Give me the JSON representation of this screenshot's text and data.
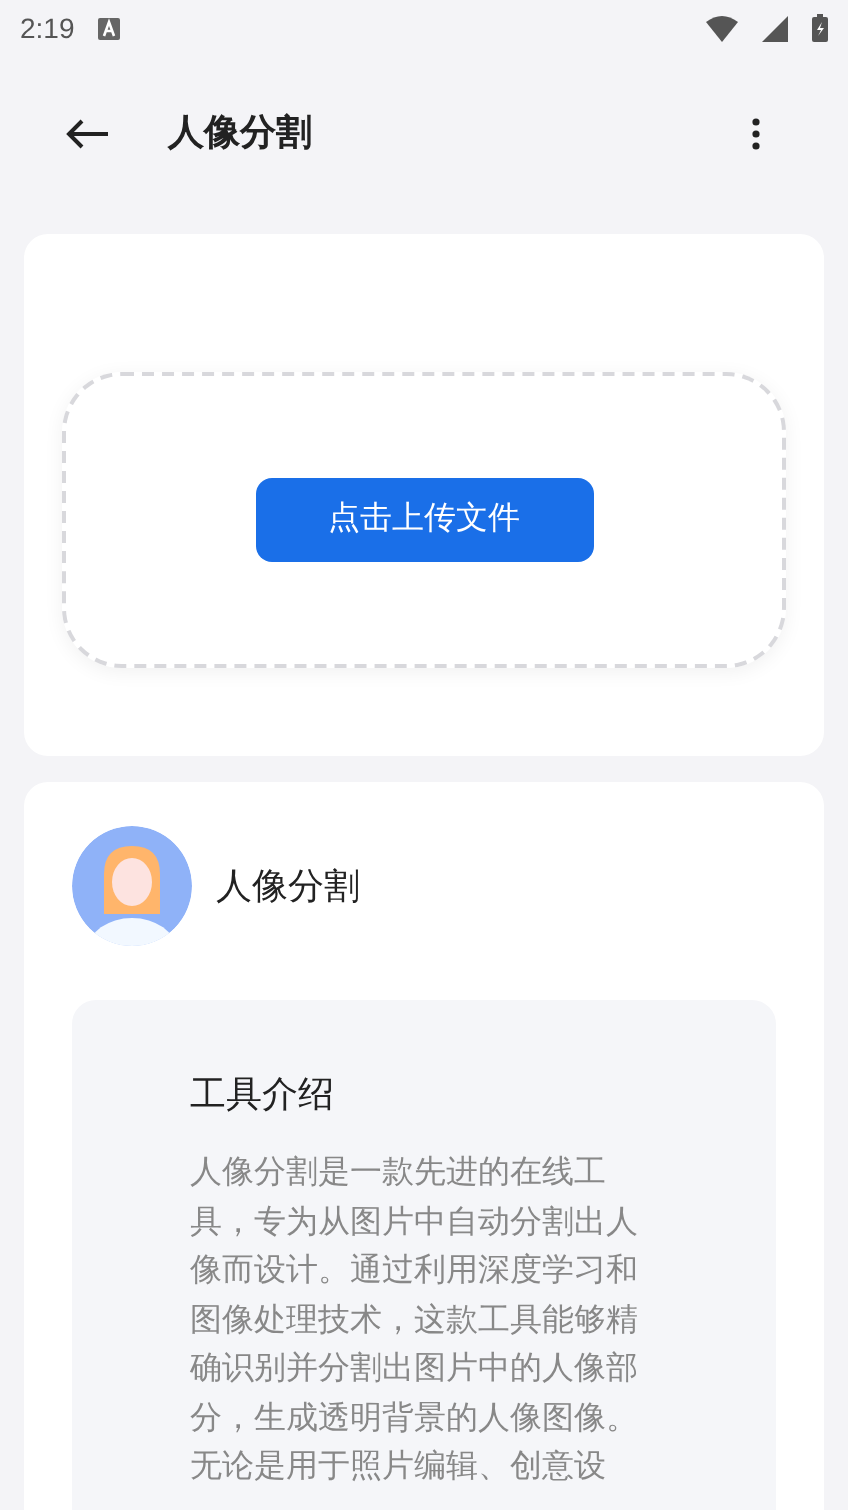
{
  "status_bar": {
    "time": "2:19"
  },
  "app_bar": {
    "title": "人像分割"
  },
  "upload": {
    "button": "点击上传文件"
  },
  "tool": {
    "name": "人像分割",
    "intro_title": "工具介绍",
    "intro_text": "人像分割是一款先进的在线工具，专为从图片中自动分割出人像而设计。通过利用深度学习和图像处理技术，这款工具能够精确识别并分割出图片中的人像部分，生成透明背景的人像图像。无论是用于照片编辑、创意设"
  }
}
